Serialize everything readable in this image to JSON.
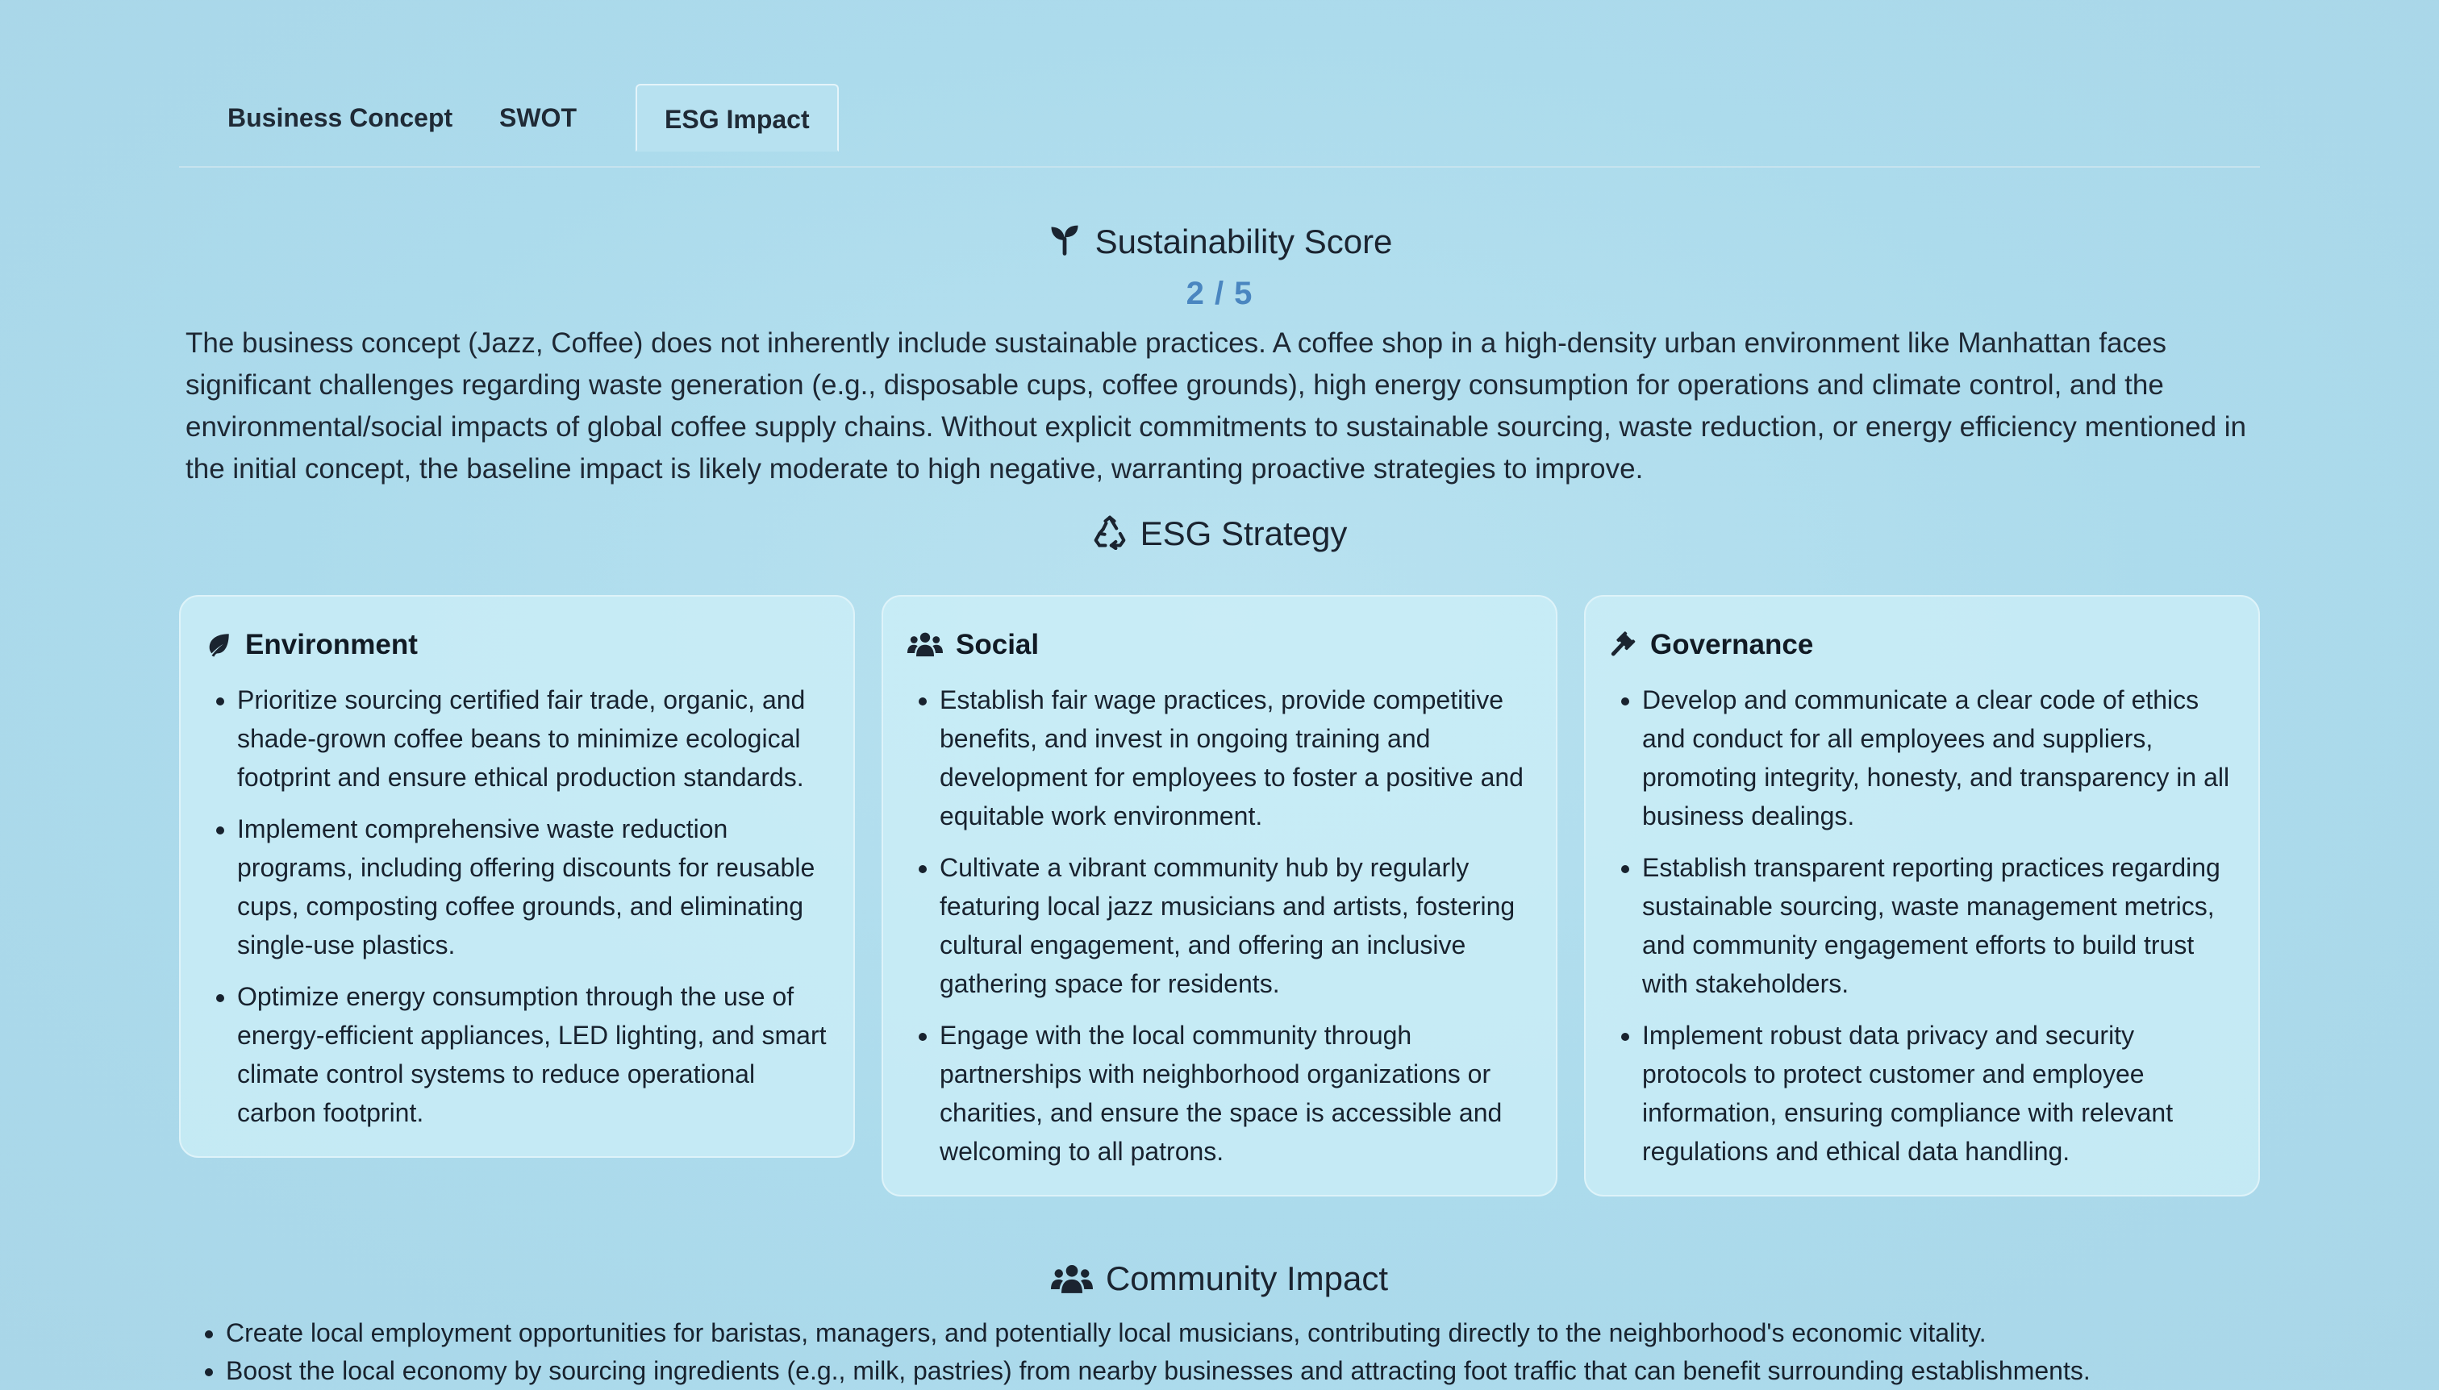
{
  "tabs": [
    {
      "label": "Business Concept",
      "active": false
    },
    {
      "label": "SWOT",
      "active": false
    },
    {
      "label": "ESG Impact",
      "active": true
    }
  ],
  "sustainability": {
    "icon": "seedling-icon",
    "title": "Sustainability Score",
    "score_text": "2 / 5",
    "score": 2,
    "score_max": 5,
    "description": "The business concept (Jazz, Coffee) does not inherently include sustainable practices. A coffee shop in a high-density urban environment like Manhattan faces significant challenges regarding waste generation (e.g., disposable cups, coffee grounds), high energy consumption for operations and climate control, and the environmental/social impacts of global coffee supply chains. Without explicit commitments to sustainable sourcing, waste reduction, or energy efficiency mentioned in the initial concept, the baseline impact is likely moderate to high negative, warranting proactive strategies to improve."
  },
  "esg": {
    "icon": "recycle-icon",
    "title": "ESG Strategy",
    "cards": [
      {
        "icon": "leaf-icon",
        "title": "Environment",
        "items": [
          "Prioritize sourcing certified fair trade, organic, and shade-grown coffee beans to minimize ecological footprint and ensure ethical production standards.",
          "Implement comprehensive waste reduction programs, including offering discounts for reusable cups, composting coffee grounds, and eliminating single-use plastics.",
          "Optimize energy consumption through the use of energy-efficient appliances, LED lighting, and smart climate control systems to reduce operational carbon footprint."
        ]
      },
      {
        "icon": "users-icon",
        "title": "Social",
        "items": [
          "Establish fair wage practices, provide competitive benefits, and invest in ongoing training and development for employees to foster a positive and equitable work environment.",
          "Cultivate a vibrant community hub by regularly featuring local jazz musicians and artists, fostering cultural engagement, and offering an inclusive gathering space for residents.",
          "Engage with the local community through partnerships with neighborhood organizations or charities, and ensure the space is accessible and welcoming to all patrons."
        ]
      },
      {
        "icon": "gavel-icon",
        "title": "Governance",
        "items": [
          "Develop and communicate a clear code of ethics and conduct for all employees and suppliers, promoting integrity, honesty, and transparency in all business dealings.",
          "Establish transparent reporting practices regarding sustainable sourcing, waste management metrics, and community engagement efforts to build trust with stakeholders.",
          "Implement robust data privacy and security protocols to protect customer and employee information, ensuring compliance with relevant regulations and ethical data handling."
        ]
      }
    ]
  },
  "community": {
    "icon": "users-icon",
    "title": "Community Impact",
    "items": [
      "Create local employment opportunities for baristas, managers, and potentially local musicians, contributing directly to the neighborhood's economic vitality.",
      "Boost the local economy by sourcing ingredients (e.g., milk, pastries) from nearby businesses and attracting foot traffic that can benefit surrounding establishments."
    ]
  }
}
